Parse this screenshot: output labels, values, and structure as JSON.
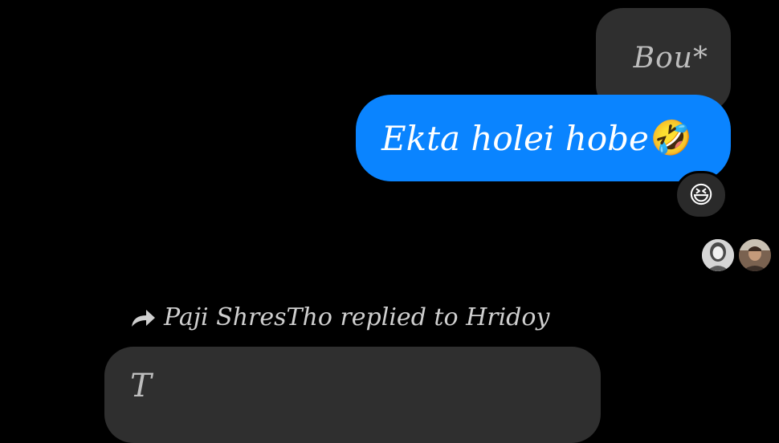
{
  "quoted_message": {
    "text": "Bou*"
  },
  "sent_message": {
    "text": "Ekta holei hobe",
    "emoji": "🤣"
  },
  "reaction": {
    "emoji": "😆"
  },
  "read_receipts": {
    "avatars": [
      "avatar-woman",
      "avatar-man"
    ]
  },
  "reply_context": {
    "text": "Paji ShresTho replied to Hridoy",
    "icon": "reply-arrow-icon"
  },
  "reply_message": {
    "text": "T"
  },
  "colors": {
    "background": "#000000",
    "sent_bubble": "#0a84ff",
    "received_bubble": "#2f2f2f"
  }
}
